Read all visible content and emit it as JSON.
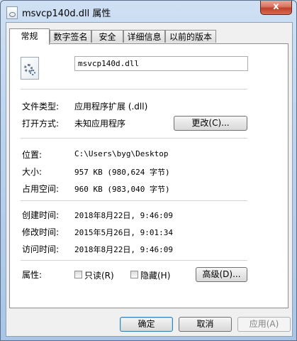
{
  "window": {
    "title": "msvcp140d.dll 属性",
    "close_glyph": "x"
  },
  "tabs": [
    {
      "label": "常规",
      "active": true
    },
    {
      "label": "数字签名",
      "active": false
    },
    {
      "label": "安全",
      "active": false
    },
    {
      "label": "详细信息",
      "active": false
    },
    {
      "label": "以前的版本",
      "active": false
    }
  ],
  "general": {
    "file_name": "msvcp140d.dll",
    "file_type_label": "文件类型:",
    "file_type_value": "应用程序扩展 (.dll)",
    "open_with_label": "打开方式:",
    "open_with_value": "未知应用程序",
    "change_button": "更改(C)...",
    "location_label": "位置:",
    "location_value": "C:\\Users\\byg\\Desktop",
    "size_label": "大小:",
    "size_value": "957 KB (980,624 字节)",
    "size_on_disk_label": "占用空间:",
    "size_on_disk_value": "960 KB (983,040 字节)",
    "created_label": "创建时间:",
    "created_value": "2018年8月22日, 9:46:09",
    "modified_label": "修改时间:",
    "modified_value": "2015年5月26日, 9:01:34",
    "accessed_label": "访问时间:",
    "accessed_value": "2018年8月22日, 9:46:09",
    "attributes_label": "属性:",
    "readonly_label": "只读(R)",
    "hidden_label": "隐藏(H)",
    "advanced_button": "高级(D)..."
  },
  "footer": {
    "ok": "确定",
    "cancel": "取消",
    "apply": "应用(A)"
  }
}
